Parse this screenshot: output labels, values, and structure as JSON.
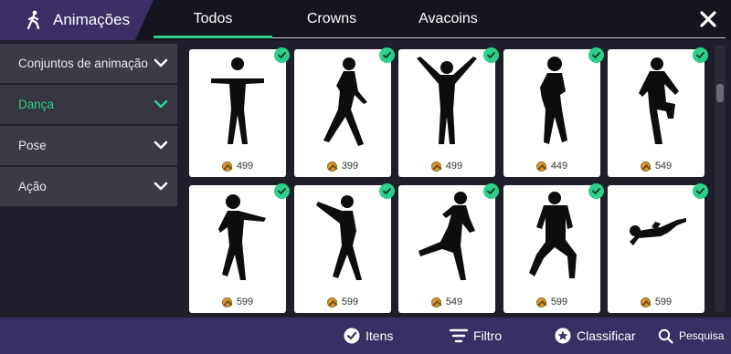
{
  "header": {
    "title": "Animações",
    "tabs": [
      {
        "label": "Todos",
        "active": true
      },
      {
        "label": "Crowns",
        "active": false
      },
      {
        "label": "Avacoins",
        "active": false
      }
    ]
  },
  "sidebar": {
    "items": [
      {
        "label": "Conjuntos de animação",
        "active": false
      },
      {
        "label": "Dança",
        "active": true
      },
      {
        "label": "Pose",
        "active": false
      },
      {
        "label": "Ação",
        "active": false
      }
    ]
  },
  "cards": [
    {
      "price": "499",
      "pose": "tpose",
      "owned": true
    },
    {
      "price": "399",
      "pose": "lunge",
      "owned": true
    },
    {
      "price": "499",
      "pose": "arms-up",
      "owned": true
    },
    {
      "price": "449",
      "pose": "hands-hips",
      "owned": true
    },
    {
      "price": "549",
      "pose": "knee-up",
      "owned": true
    },
    {
      "price": "599",
      "pose": "point",
      "owned": true
    },
    {
      "price": "599",
      "pose": "side-step",
      "owned": true
    },
    {
      "price": "549",
      "pose": "kick",
      "owned": true
    },
    {
      "price": "599",
      "pose": "squat",
      "owned": true
    },
    {
      "price": "599",
      "pose": "lying",
      "owned": true
    }
  ],
  "bottom_bar": {
    "items_label": "Itens",
    "filter_label": "Filtro",
    "sort_label": "Classificar",
    "search_label": "Pesquisa"
  },
  "colors": {
    "accent": "#2ecf8a",
    "title_bg": "#3b2f66",
    "bottom_bar": "#3a2f63",
    "sidebar_item": "#3b3b45",
    "coin": "#d39a35"
  }
}
